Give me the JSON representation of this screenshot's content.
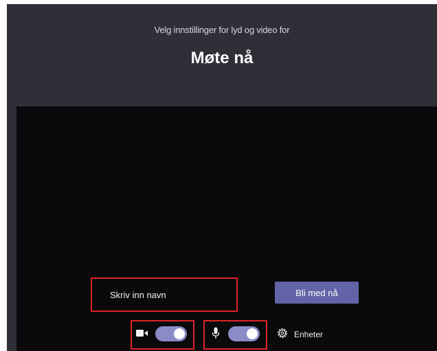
{
  "prejoin": {
    "subtitle": "Velg innstillinger for lyd og video for",
    "meeting_title": "Møte nå"
  },
  "name_field": {
    "placeholder": "Skriv inn navn",
    "value": ""
  },
  "join_button": {
    "label": "Bli med nå"
  },
  "camera": {
    "icon": "camera-icon",
    "enabled": true
  },
  "microphone": {
    "icon": "microphone-icon",
    "enabled": true
  },
  "devices": {
    "icon": "gear-icon",
    "label": "Enheter"
  },
  "colors": {
    "header_background": "#2f2f38",
    "video_background": "#0a0a0c",
    "accent": "#6264a7",
    "toggle_on": "#8b8cc7",
    "highlight": "#e0232b"
  }
}
